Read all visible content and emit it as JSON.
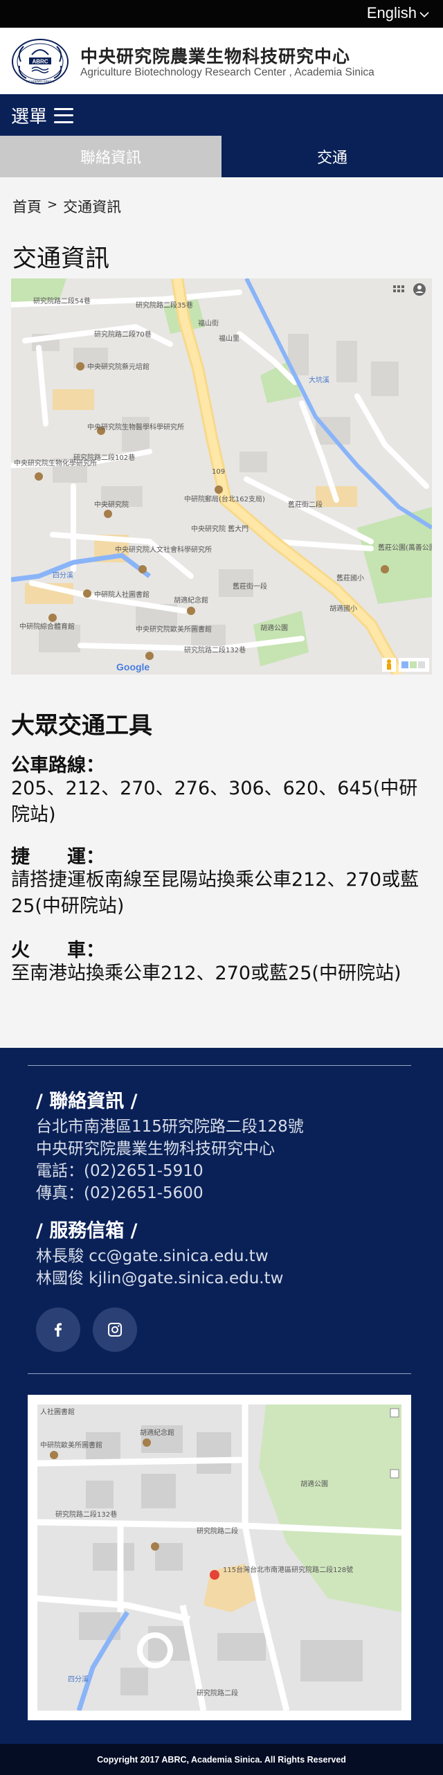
{
  "lang_switch": "English",
  "site": {
    "title": "中央研究院農業生物科技研究中心",
    "subtitle": "Agriculture Biotechnology Research Center , Academia Sinica",
    "logo_text": "ABRC",
    "logo_sub": "ACADEMIA SINICA"
  },
  "menu": {
    "label": "選單"
  },
  "tabs": [
    {
      "label": "聯絡資訊",
      "active": false
    },
    {
      "label": "交通",
      "active": true
    }
  ],
  "breadcrumb": {
    "home": "首頁",
    "sep": ">",
    "current": "交通資訊"
  },
  "page_title": "交通資訊",
  "map_labels": {
    "l1": "研究院路二段54巷",
    "l2": "研究院路二段35巷",
    "l3": "研究院路二段70巷",
    "l4": "福山街",
    "l5": "中央研究院蔡元培館",
    "l6": "中央研究院生物醫學科學研究所",
    "l7": "中央研究院生物化學研究所",
    "l8": "研究院路二段102巷",
    "l9": "中央研究院",
    "l10": "中研院郵局(台北162支局)",
    "l11": "中央研究院人文社會科學研究所",
    "l12": "中央研究院 舊大門",
    "l13": "中研院人社圖書館",
    "l14": "胡適紀念館",
    "l15": "中央研究院歐美所圖書館",
    "l16": "中研院綜合體育館",
    "l17": "研究院路二段132巷",
    "l18": "胡適公園",
    "l19": "舊莊國小",
    "l20": "舊莊公園(萬善公園)",
    "l21": "四分溪",
    "l22": "舊莊街一段",
    "l23": "109",
    "l24": "Google",
    "l25": "胡適國小",
    "l26": "福山里",
    "l27": "大坑溪",
    "l28": "舊莊街二段"
  },
  "transit": {
    "heading": "大眾交通工具",
    "bus_label": "公車路線：",
    "bus_text": "205、212、270、276、306、620、645(中研院站)",
    "mrt_label": "捷　　運：",
    "mrt_text": "請搭捷運板南線至昆陽站換乘公車212、270或藍25(中研院站)",
    "train_label": "火　　車：",
    "train_text": "至南港站換乘公車212、270或藍25(中研院站)"
  },
  "footer": {
    "contact_heading": "/ 聯絡資訊 /",
    "address": "台北市南港區115研究院路二段128號",
    "org": "中央研究院農業生物科技研究中心",
    "phone": "電話：(02)2651-5910",
    "fax": "傳真：(02)2651-5600",
    "service_heading": "/ 服務信箱 /",
    "mail1": "林長駿  cc@gate.sinica.edu.tw",
    "mail2": "林國俊  kjlin@gate.sinica.edu.tw",
    "map_labels": {
      "m1": "胡適紀念館",
      "m2": "中研院歐美所圖書館",
      "m3": "胡適公園",
      "m4": "研究院路二段132巷",
      "m5": "研究院路二段",
      "m6": "115台灣台北市南港區研究院路二段128號",
      "m7": "四分溪",
      "m8": "研究院路二段",
      "m9": "人社圖書館"
    },
    "copyright": "Copyright 2017 ABRC, Academia Sinica. All Rights Reserved"
  },
  "colors": {
    "navy": "#0a2158",
    "tab_inactive": "#c9c9c9",
    "footer_text": "#d8dde8"
  }
}
